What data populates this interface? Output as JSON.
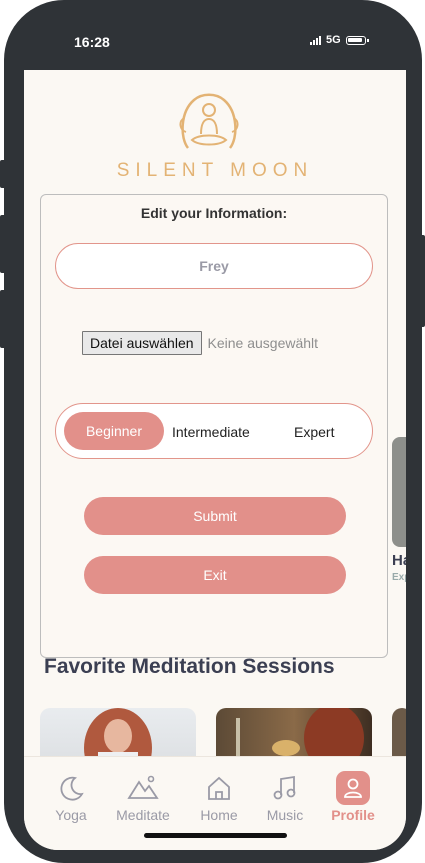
{
  "status": {
    "time": "16:28",
    "network": "5G"
  },
  "brand": {
    "name": "SILENT MOON"
  },
  "form": {
    "title": "Edit your Information:",
    "name_value": "Frey",
    "file_button": "Datei auswählen",
    "file_status": "Keine ausgewählt",
    "levels": [
      "Beginner",
      "Intermediate",
      "Expert"
    ],
    "selected_level": "Beginner",
    "submit_label": "Submit",
    "exit_label": "Exit"
  },
  "peek_card": {
    "title": "Ha",
    "subtitle": "Exp"
  },
  "favorites": {
    "title": "Favorite Meditation Sessions"
  },
  "nav": {
    "items": [
      {
        "label": "Yoga",
        "icon": "moon-icon"
      },
      {
        "label": "Meditate",
        "icon": "mountain-icon"
      },
      {
        "label": "Home",
        "icon": "home-icon"
      },
      {
        "label": "Music",
        "icon": "music-icon"
      },
      {
        "label": "Profile",
        "icon": "profile-icon"
      }
    ],
    "active": "Profile"
  },
  "colors": {
    "accent": "#e2908a",
    "gold": "#e3b374",
    "text": "#3b3f52"
  }
}
